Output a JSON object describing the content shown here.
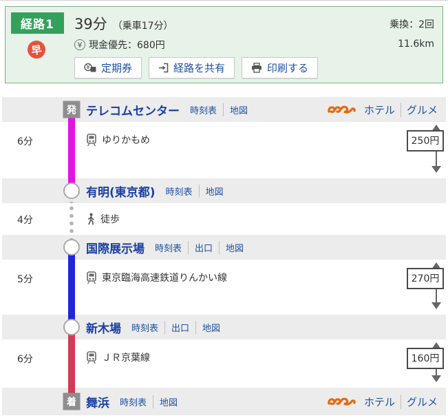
{
  "summary": {
    "route_badge": "経路1",
    "fast_badge": "早",
    "duration": "39分",
    "ride_time": "（乗車17分）",
    "fare_icon": "¥",
    "fare": "現金優先：680円",
    "transfers": "乗換：2回",
    "distance": "11.6km",
    "buttons": {
      "pass": "定期券",
      "share": "経路を共有",
      "print": "印刷する"
    }
  },
  "route": {
    "rows": [
      {
        "type": "station",
        "badge": "発",
        "name": "テレコムセンター",
        "links": [
          "時刻表",
          "地図"
        ],
        "right_links": [
          "ホテル",
          "グルメ"
        ],
        "line_below": "#e511e5"
      },
      {
        "type": "segment",
        "mode": "train",
        "duration": "6分",
        "line_name": "ゆりかもめ",
        "line_color": "#e511e5",
        "fare": "250円"
      },
      {
        "type": "station",
        "name": "有明(東京都)",
        "links": [
          "時刻表",
          "地図"
        ],
        "line_above": "#e511e5"
      },
      {
        "type": "segment",
        "mode": "walk",
        "duration": "4分",
        "line_name": "徒歩"
      },
      {
        "type": "station",
        "name": "国際展示場",
        "links": [
          "時刻表",
          "出口",
          "地図"
        ],
        "line_below": "#2125d8"
      },
      {
        "type": "segment",
        "mode": "train",
        "duration": "5分",
        "line_name": "東京臨海高速鉄道りんかい線",
        "line_color": "#2125d8",
        "fare": "270円"
      },
      {
        "type": "station",
        "name": "新木場",
        "links": [
          "時刻表",
          "出口",
          "地図"
        ],
        "line_above": "#2125d8",
        "line_below": "#d23a56"
      },
      {
        "type": "segment",
        "mode": "train",
        "duration": "6分",
        "line_name": "ＪＲ京葉線",
        "line_color": "#d23a56",
        "fare": "160円"
      },
      {
        "type": "station",
        "badge": "着",
        "name": "舞浜",
        "links": [
          "時刻表",
          "地図"
        ],
        "right_links": [
          "ホテル",
          "グルメ"
        ],
        "line_above": "#d23a56"
      }
    ]
  },
  "colors": {
    "route_badge_green": "#33a15c",
    "fast_badge_red": "#e5533d",
    "link_blue": "#1e51a2",
    "station_name_blue": "#1a3fa5",
    "yurikamome_magenta": "#e511e5",
    "rinkai_blue": "#2125d8",
    "keiyo_red": "#d23a56",
    "station_row_gray": "#ececec",
    "summary_bg_green": "#e7f2e8"
  }
}
